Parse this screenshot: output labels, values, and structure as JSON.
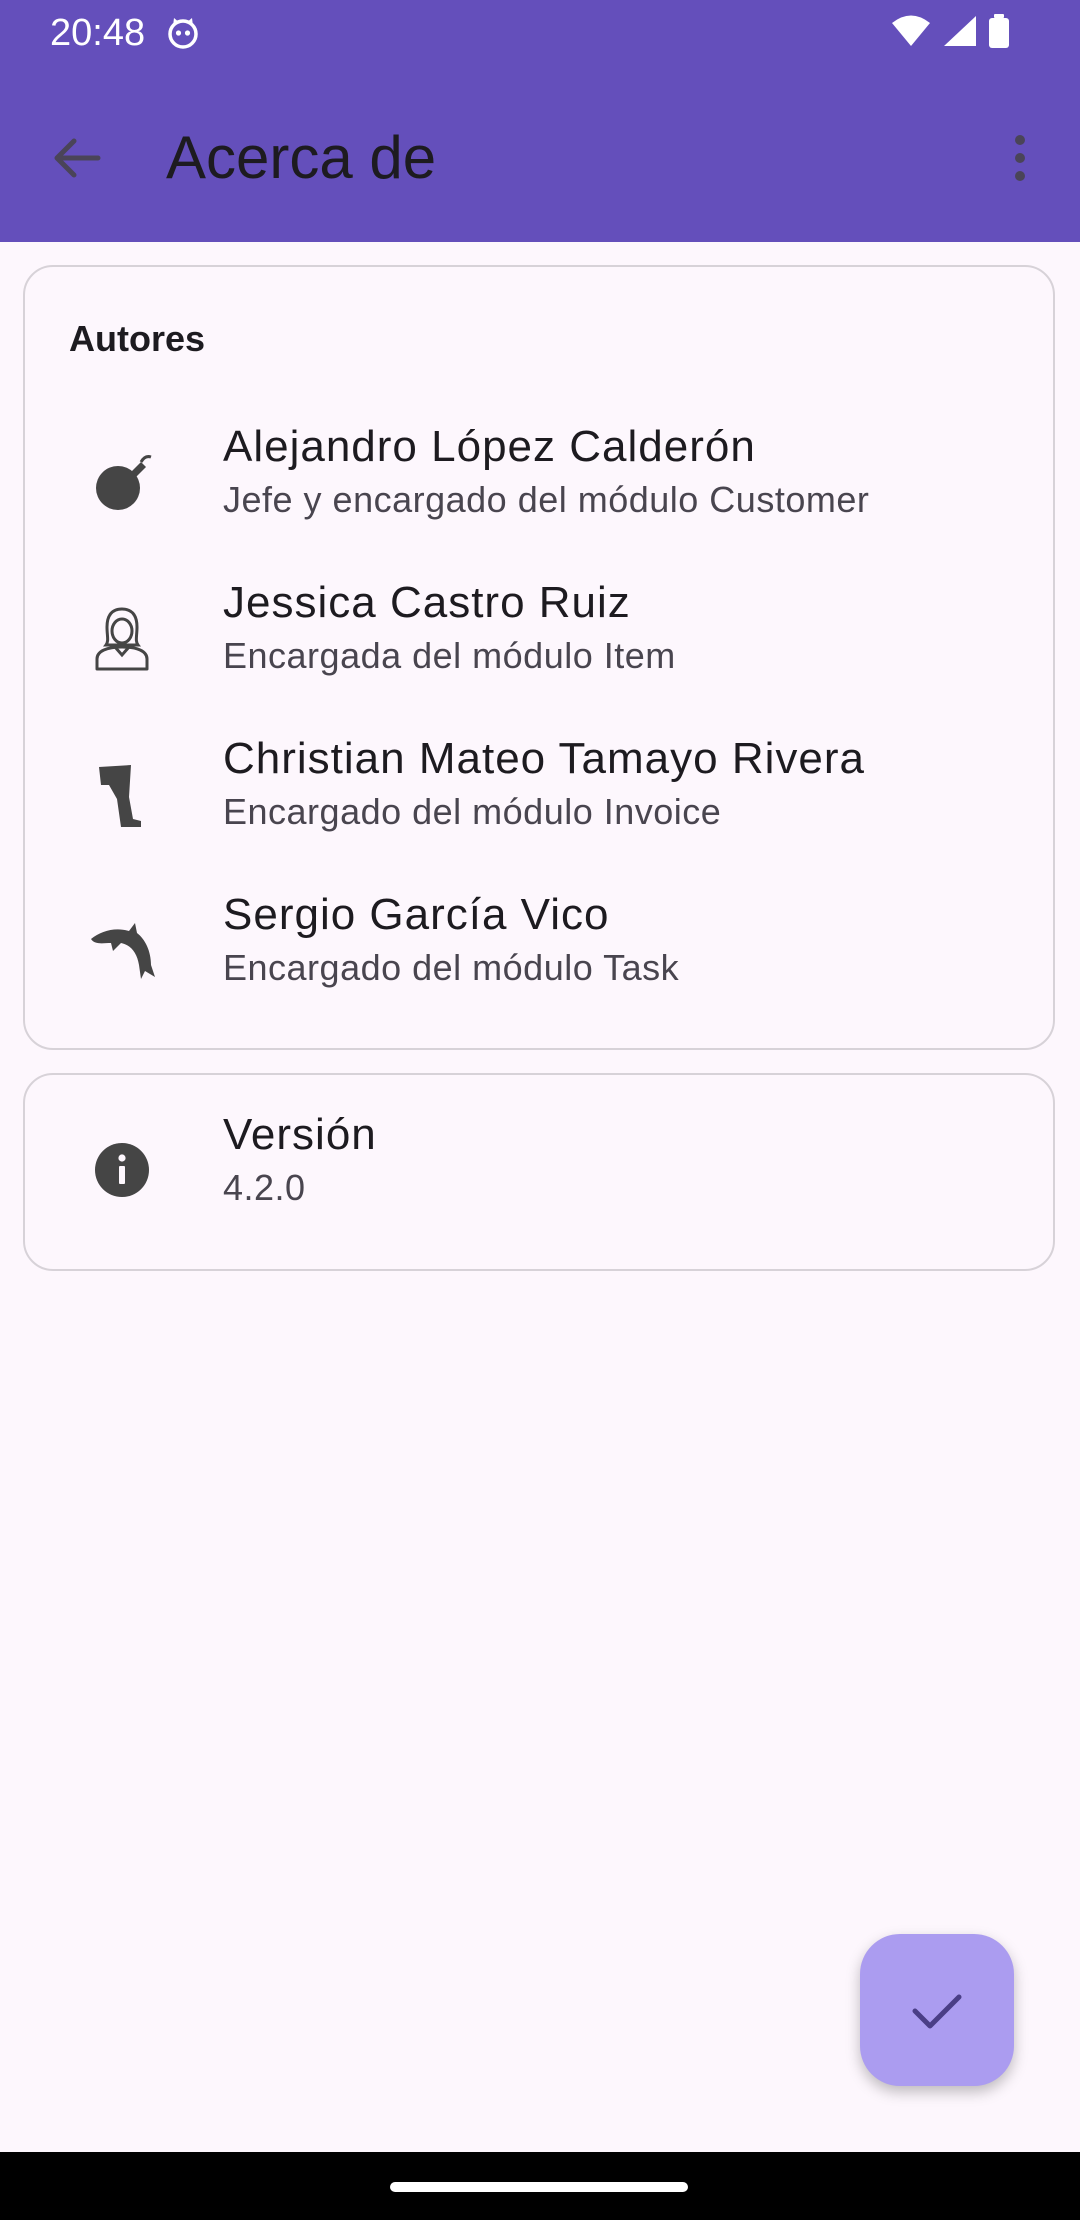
{
  "status_bar": {
    "time": "20:48",
    "icons": [
      "cat-notification-icon",
      "wifi-icon",
      "signal-icon",
      "battery-icon"
    ]
  },
  "app_bar": {
    "title": "Acerca de",
    "back_icon": "arrow-back-icon",
    "menu_icon": "more-vert-icon",
    "color": "#644fbb"
  },
  "authors_card": {
    "title": "Autores",
    "items": [
      {
        "name": "Alejandro López Calderón",
        "role": "Jefe y encargado del módulo Customer",
        "icon": "bomb-icon"
      },
      {
        "name": "Jessica Castro Ruiz",
        "role": "Encargada del módulo Item",
        "icon": "woman-avatar-icon"
      },
      {
        "name": "Christian Mateo Tamayo Rivera",
        "role": "Encargado del módulo Invoice",
        "icon": "leg-icon"
      },
      {
        "name": "Sergio García Vico",
        "role": "Encargado del módulo Task",
        "icon": "dolphin-icon"
      }
    ]
  },
  "version_card": {
    "label": "Versión",
    "value": "4.2.0",
    "icon": "info-icon"
  },
  "fab": {
    "icon": "check-icon",
    "color": "#ab9cf0"
  }
}
